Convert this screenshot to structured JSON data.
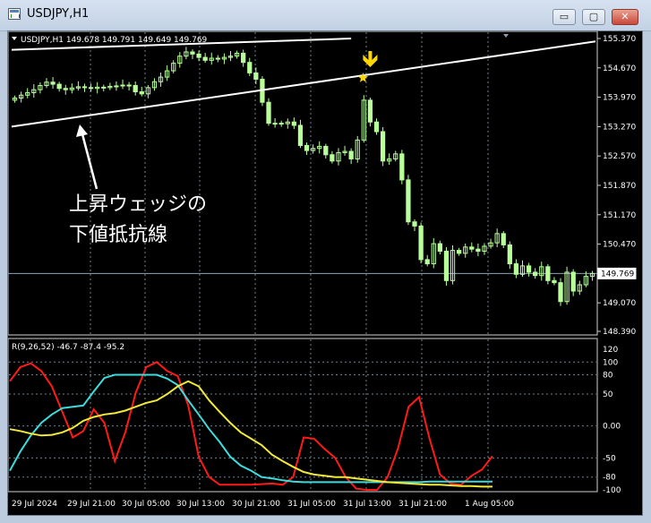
{
  "window": {
    "title": "USDJPY,H1",
    "controls": {
      "minimize": "▭",
      "maximize": "▢",
      "close": "✕"
    }
  },
  "main_panel": {
    "info_text": "USDJPY,H1  149.678 149.791 149.649 149.769",
    "price_labels": [
      "155.370",
      "154.670",
      "153.970",
      "153.270",
      "152.570",
      "151.870",
      "151.170",
      "150.470",
      "149.769",
      "149.070",
      "148.390"
    ],
    "current_price": "149.769",
    "annotation_line1": "上昇ウェッジの",
    "annotation_line2": "下値抵抗線"
  },
  "indicator_panel": {
    "info_text": "R(9,26,52) -46.7 -87.4 -95.2",
    "levels": [
      "120",
      "100",
      "80",
      "50",
      "0.00",
      "-50",
      "-80",
      "-100"
    ]
  },
  "time_axis": [
    "29 Jul 2024",
    "29 Jul 21:00",
    "30 Jul 05:00",
    "30 Jul 13:00",
    "30 Jul 21:00",
    "31 Jul 05:00",
    "31 Jul 13:00",
    "31 Jul 21:00",
    "1 Aug 05:00"
  ],
  "colors": {
    "background": "#000000",
    "candle": "#b8ff9a",
    "trendline": "#ffffff",
    "grid": "#6f7f8f",
    "current_price": "#8ea2b6",
    "arrow": "#ffd700",
    "rsi_fast": "#ff1a1a",
    "rsi_mid": "#3ddcdc",
    "rsi_slow": "#f2ea36"
  },
  "chart_data": {
    "type": "candlestick",
    "symbol": "USDJPY",
    "timeframe": "H1",
    "ohlc_last": {
      "open": 149.678,
      "high": 149.791,
      "low": 149.649,
      "close": 149.769
    },
    "ylim": [
      148.39,
      155.37
    ],
    "closes": [
      153.95,
      154.02,
      154.08,
      154.15,
      154.25,
      154.33,
      154.28,
      154.18,
      154.15,
      154.19,
      154.22,
      154.2,
      154.18,
      154.21,
      154.2,
      154.23,
      154.24,
      154.26,
      154.25,
      154.1,
      154.05,
      154.2,
      154.34,
      154.45,
      154.6,
      154.78,
      154.95,
      155.05,
      155.0,
      154.92,
      154.85,
      154.9,
      154.88,
      154.92,
      154.95,
      155.02,
      154.8,
      154.55,
      154.4,
      153.85,
      153.35,
      153.35,
      153.34,
      153.38,
      153.3,
      152.82,
      152.7,
      152.75,
      152.8,
      152.6,
      152.45,
      152.65,
      152.68,
      152.5,
      152.95,
      153.9,
      153.38,
      153.15,
      152.45,
      152.5,
      152.62,
      152.0,
      151.0,
      150.9,
      150.1,
      150.0,
      150.48,
      150.3,
      149.6,
      150.32,
      150.25,
      150.4,
      150.35,
      150.3,
      150.42,
      150.5,
      150.72,
      150.45,
      150.0,
      149.75,
      149.95,
      149.8,
      149.72,
      149.93,
      149.6,
      149.55,
      149.1,
      149.8,
      149.35,
      149.5,
      149.7,
      149.77
    ],
    "wedge_lower_line": {
      "from": {
        "index": 0,
        "price": 153.27
      },
      "to": {
        "index": 91,
        "price": 155.3
      }
    },
    "wedge_upper_line": {
      "from": {
        "index": 0,
        "price": 155.1
      },
      "to": {
        "index": 53,
        "price": 155.37
      }
    },
    "marker_index": 56,
    "rsi": {
      "params": [
        9,
        26,
        52
      ],
      "ylim": [
        -100,
        120
      ],
      "levels": [
        120,
        100,
        80,
        50,
        0,
        -50,
        -80,
        -100
      ],
      "series": [
        {
          "name": "R9",
          "last": -46.7,
          "values": [
            70,
            92,
            98,
            86,
            62,
            22,
            -18,
            -8,
            26,
            5,
            -55,
            -10,
            52,
            92,
            100,
            86,
            78,
            32,
            -48,
            -80,
            -92,
            -92,
            -92,
            -92,
            -91,
            -90,
            -92,
            -80,
            -18,
            -20,
            -36,
            -50,
            -80,
            -98,
            -100,
            -100,
            -80,
            -35,
            30,
            45,
            -20,
            -76,
            -90,
            -92,
            -78,
            -68,
            -47
          ]
        },
        {
          "name": "R26",
          "last": -87.4,
          "values": [
            -70,
            -40,
            -15,
            5,
            18,
            28,
            30,
            32,
            54,
            75,
            80,
            80,
            80,
            80,
            80,
            74,
            64,
            40,
            18,
            -5,
            -25,
            -48,
            -62,
            -70,
            -80,
            -82,
            -85,
            -87,
            -88,
            -88,
            -88,
            -88,
            -88,
            -88,
            -88,
            -88,
            -88,
            -88,
            -88,
            -88,
            -87,
            -87,
            -87,
            -87,
            -87,
            -87,
            -87
          ]
        },
        {
          "name": "R52",
          "last": -95.2,
          "values": [
            -5,
            -8,
            -12,
            -15,
            -14,
            -10,
            -3,
            8,
            14,
            18,
            20,
            24,
            30,
            36,
            40,
            50,
            62,
            70,
            62,
            40,
            22,
            5,
            -10,
            -20,
            -30,
            -45,
            -55,
            -64,
            -72,
            -76,
            -78,
            -80,
            -80,
            -82,
            -84,
            -86,
            -88,
            -89,
            -90,
            -91,
            -92,
            -92,
            -93,
            -94,
            -94,
            -95,
            -95
          ]
        }
      ]
    }
  }
}
